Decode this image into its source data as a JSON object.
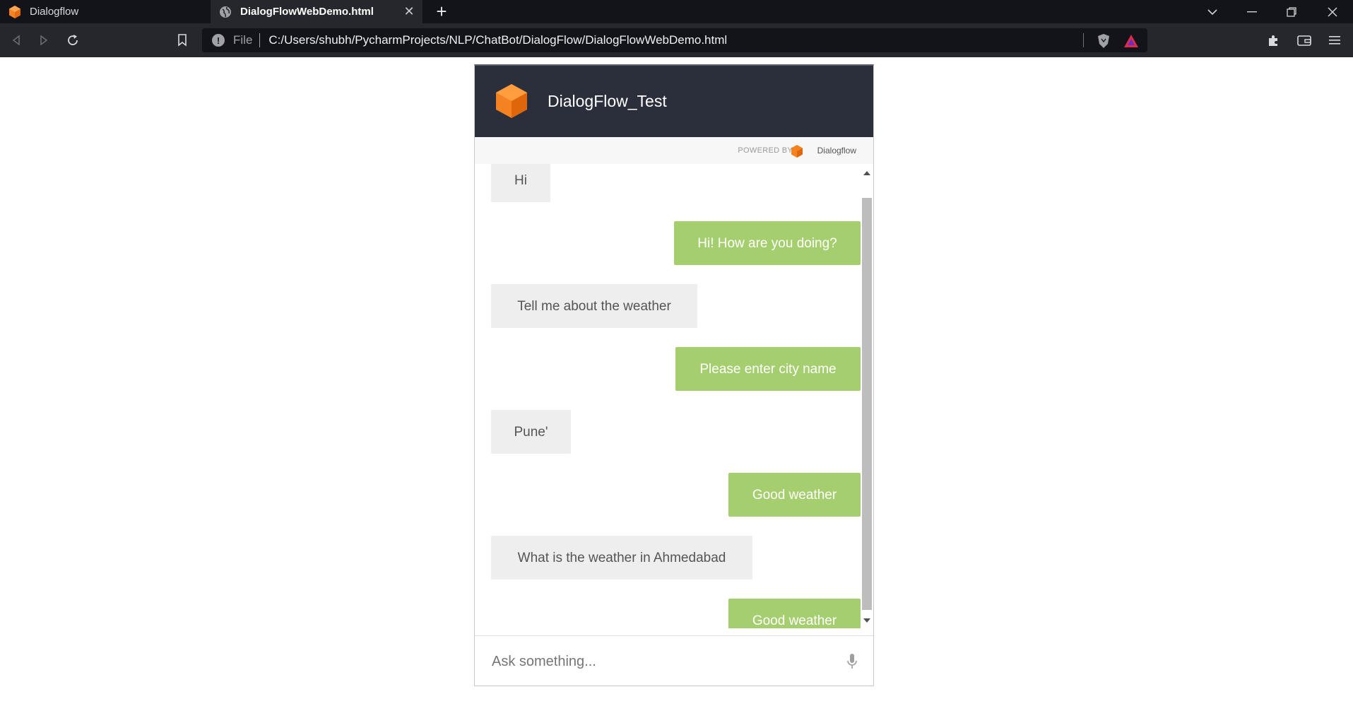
{
  "browser": {
    "tabs": [
      {
        "title": "Dialogflow",
        "active": false,
        "icon": "dialogflow-cube-icon"
      },
      {
        "title": "DialogFlowWebDemo.html",
        "active": true,
        "icon": "globe-icon"
      }
    ],
    "new_tab_label": "+",
    "address": {
      "scheme_label": "File",
      "url": "C:/Users/shubh/PycharmProjects/NLP/ChatBot/DialogFlow/DialogFlowWebDemo.html"
    }
  },
  "chat": {
    "agent_name": "DialogFlow_Test",
    "powered_by_label": "POWERED BY",
    "brand_name": "Dialogflow",
    "messages": [
      {
        "from": "user",
        "text": "Hi"
      },
      {
        "from": "bot",
        "text": "Hi! How are you doing?"
      },
      {
        "from": "user",
        "text": "Tell me about the weather"
      },
      {
        "from": "bot",
        "text": "Please enter city name"
      },
      {
        "from": "user",
        "text": "Pune'"
      },
      {
        "from": "bot",
        "text": "Good weather"
      },
      {
        "from": "user",
        "text": "What is the weather in Ahmedabad"
      },
      {
        "from": "bot",
        "text": "Good weather"
      }
    ],
    "input_placeholder": "Ask something...",
    "colors": {
      "header_bg": "#2a2f3b",
      "bot_bubble": "#a5cf6e",
      "user_bubble": "#eeeeee",
      "brand_orange": "#f58220"
    }
  }
}
